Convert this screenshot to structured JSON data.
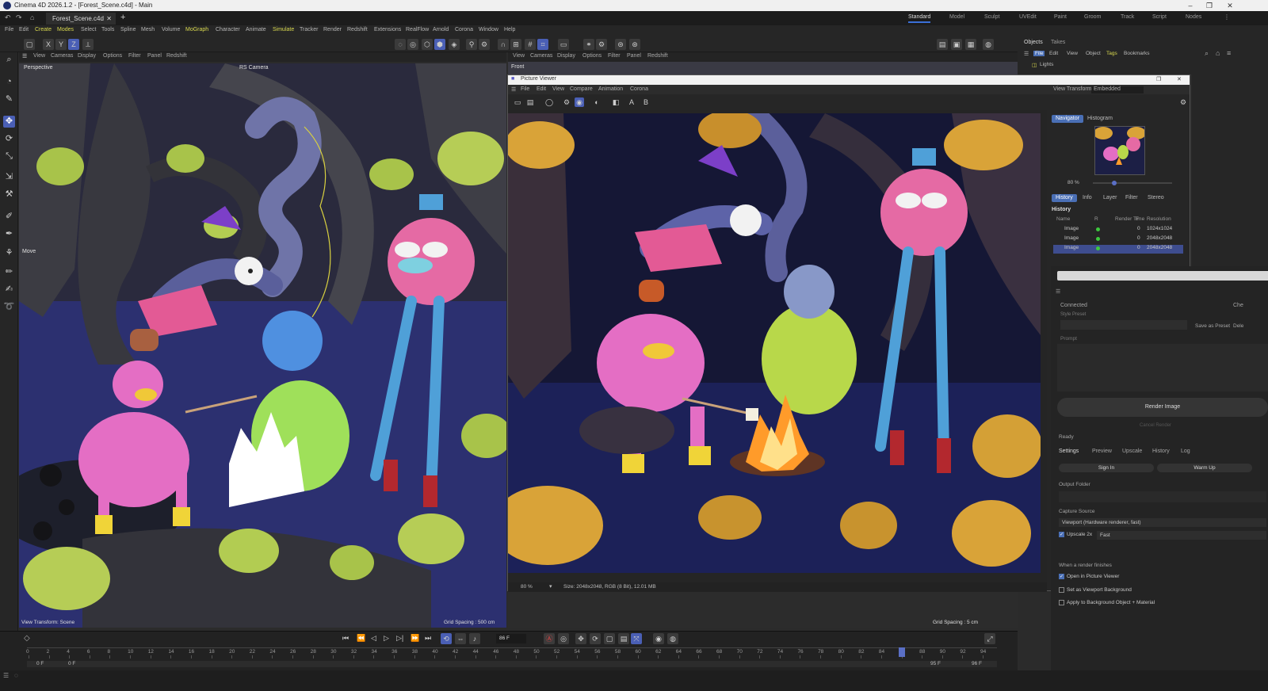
{
  "window": {
    "title": "Cinema 4D 2026.1.2 - [Forest_Scene.c4d] - Main",
    "file_tab": "Forest_Scene.c4d"
  },
  "layouts": [
    "Standard",
    "Model",
    "Sculpt",
    "UVEdit",
    "Paint",
    "Groom",
    "Track",
    "Script",
    "Nodes"
  ],
  "menu": [
    "File",
    "Edit",
    "Create",
    "Modes",
    "Select",
    "Tools",
    "Spline",
    "Mesh",
    "Volume",
    "MoGraph",
    "Character",
    "Animate",
    "Simulate",
    "Tracker",
    "Render",
    "Redshift",
    "Extensions",
    "RealFlow",
    "Arnold",
    "Corona",
    "Window",
    "Help"
  ],
  "axis_buttons": [
    "X",
    "Y",
    "Z"
  ],
  "viewport_left": {
    "menu": [
      "View",
      "Cameras",
      "Display",
      "Options",
      "Filter",
      "Panel",
      "Redshift"
    ],
    "label": "Perspective",
    "camera": "RS Camera",
    "tool_label": "Move",
    "footer_left": "View Transform: Scene",
    "footer_right": "Grid Spacing : 500 cm"
  },
  "viewport_right": {
    "menu": [
      "View",
      "Cameras",
      "Display",
      "Options",
      "Filter",
      "Panel",
      "Redshift"
    ],
    "label": "Front",
    "footer_right": "Grid Spacing : 5 cm"
  },
  "picture_viewer": {
    "title": "Picture Viewer",
    "menu": [
      "File",
      "Edit",
      "View",
      "Compare",
      "Animation",
      "Corona"
    ],
    "view_transform_label": "View Transform",
    "view_transform_value": "Embedded",
    "zoom": "80 %",
    "info": "Size: 2048x2048, RGB (8 Bit), 12.01 MB",
    "nav_tabs": [
      "Navigator",
      "Histogram"
    ],
    "nav_zoom": "80 %",
    "tabs": [
      "History",
      "Info",
      "Layer",
      "Filter",
      "Stereo"
    ],
    "history_title": "History",
    "history_cols": [
      "Name",
      "R",
      "Render Time",
      "F",
      "Resolution"
    ],
    "history_rows": [
      {
        "name": "Image",
        "f": "0",
        "res": "1024x1024"
      },
      {
        "name": "Image",
        "f": "0",
        "res": "2048x2048"
      },
      {
        "name": "Image",
        "f": "0",
        "res": "2048x2048"
      }
    ]
  },
  "objects_panel": {
    "tabs": [
      "Objects",
      "Takes"
    ],
    "menu": [
      "File",
      "Edit",
      "View",
      "Object",
      "Tags",
      "Bookmarks"
    ],
    "item": "Lights"
  },
  "render_panel": {
    "connected": "Connected",
    "style_preset": "Style Preset",
    "save_preset": "Save as Preset",
    "delete": "Dele",
    "prompt": "Prompt",
    "render_button": "Render Image",
    "cancel_button": "Cancel Render",
    "status": "Ready",
    "tabs": [
      "Settings",
      "Preview",
      "Upscale",
      "History",
      "Log"
    ],
    "sign_in": "Sign In",
    "warm_up": "Warm Up",
    "output_folder": "Output Folder",
    "capture_source": "Capture Source",
    "capture_value": "Viewport (Hardware renderer, fast)",
    "upscale_label": "Upscale 2x",
    "upscale_mode": "Fast",
    "when_finishes": "When a render finishes",
    "opt1": "Open in Picture Viewer",
    "opt2": "Set as Viewport Background",
    "opt3": "Apply to Background Object + Material",
    "chk_cut": "Che"
  },
  "timeline": {
    "current_frame": "86 F",
    "start": "0 F",
    "start2": "0 F",
    "end": "95 F",
    "end2": "96 F",
    "ticks": [
      "0",
      "2",
      "4",
      "6",
      "8",
      "10",
      "12",
      "14",
      "16",
      "18",
      "20",
      "22",
      "24",
      "26",
      "28",
      "30",
      "32",
      "34",
      "36",
      "38",
      "40",
      "42",
      "44",
      "46",
      "48",
      "50",
      "52",
      "54",
      "56",
      "58",
      "60",
      "62",
      "64",
      "66",
      "68",
      "70",
      "72",
      "74",
      "76",
      "78",
      "80",
      "82",
      "84",
      "86",
      "88",
      "90",
      "92",
      "94"
    ],
    "playhead_frame": 86
  },
  "colors": {
    "accent": "#4a5fb5",
    "highlight_menu": "#d9d94f",
    "bg": "#2b2b2b"
  }
}
